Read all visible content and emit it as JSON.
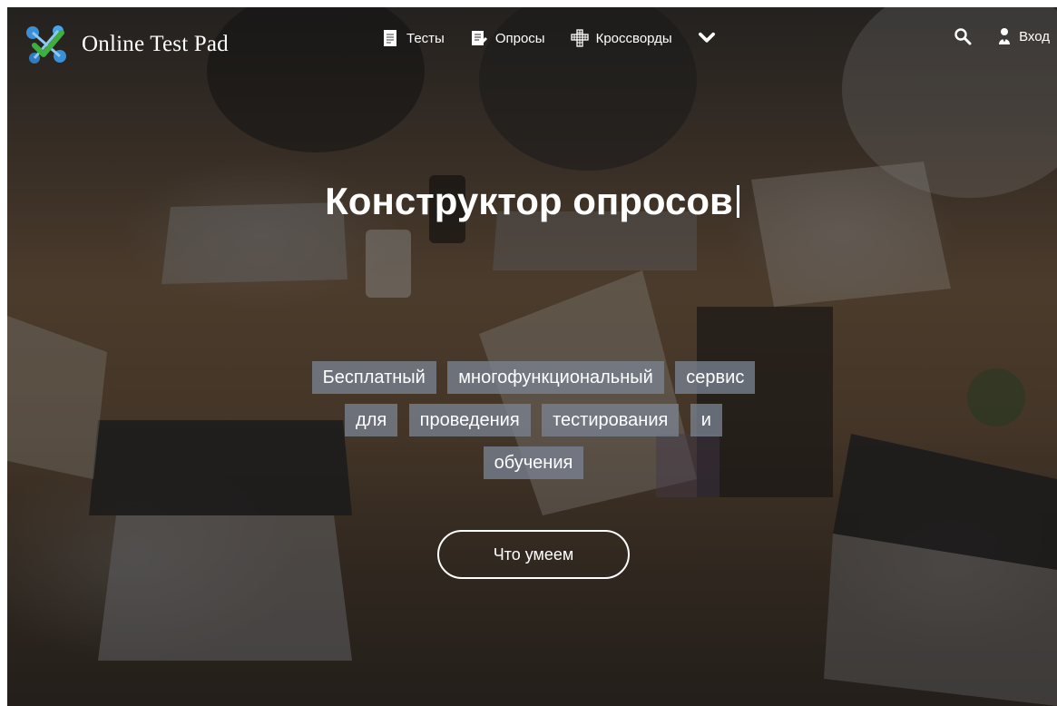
{
  "brand": {
    "name": "Online Test Pad"
  },
  "nav": {
    "items": [
      {
        "label": "Тесты",
        "icon": "test-sheet-icon"
      },
      {
        "label": "Опросы",
        "icon": "survey-icon"
      },
      {
        "label": "Кроссворды",
        "icon": "crossword-icon"
      }
    ],
    "more_icon": "chevron-down-icon",
    "search_icon": "search-icon",
    "login_label": "Вход",
    "login_icon": "user-icon"
  },
  "hero": {
    "title": "Конструктор опросов",
    "tags": [
      "Бесплатный",
      "многофункциональный",
      "сервис",
      "для",
      "проведения",
      "тестирования",
      "и",
      "обучения"
    ],
    "cta_label": "Что умеем"
  },
  "colors": {
    "tag_bg": "#7b8491",
    "text": "#ffffff"
  }
}
